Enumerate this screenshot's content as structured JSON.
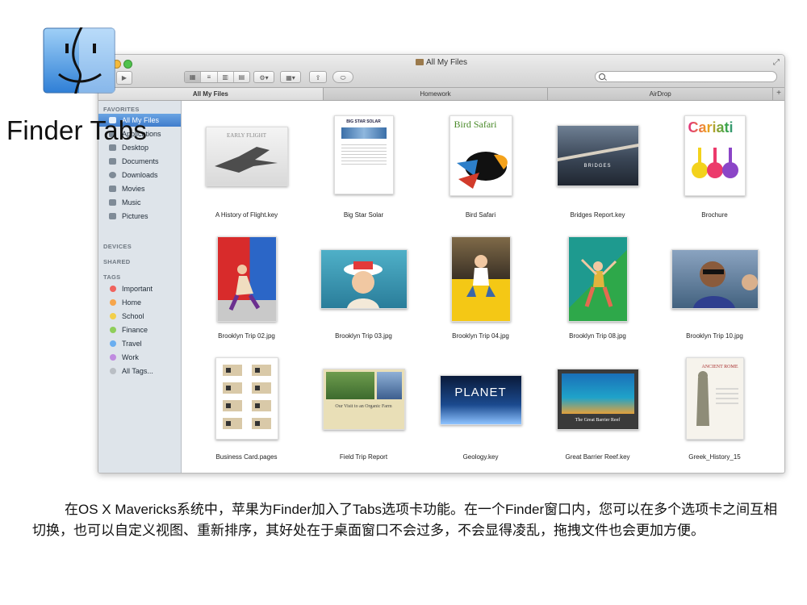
{
  "headline": "Finder Tabs",
  "window": {
    "title": "All My Files",
    "search_placeholder": ""
  },
  "tabs": [
    {
      "label": "All My Files",
      "active": true
    },
    {
      "label": "Homework",
      "active": false
    },
    {
      "label": "AirDrop",
      "active": false
    }
  ],
  "sidebar": {
    "favorites_header": "FAVORITES",
    "favorites": [
      {
        "label": "All My Files",
        "icon": "all-files-icon",
        "selected": true
      },
      {
        "label": "Applications",
        "icon": "applications-icon",
        "selected": false
      },
      {
        "label": "Desktop",
        "icon": "desktop-icon",
        "selected": false
      },
      {
        "label": "Documents",
        "icon": "documents-icon",
        "selected": false
      },
      {
        "label": "Downloads",
        "icon": "downloads-icon",
        "selected": false
      },
      {
        "label": "Movies",
        "icon": "movies-icon",
        "selected": false
      },
      {
        "label": "Music",
        "icon": "music-icon",
        "selected": false
      },
      {
        "label": "Pictures",
        "icon": "pictures-icon",
        "selected": false
      }
    ],
    "devices_header": "DEVICES",
    "shared_header": "SHARED",
    "tags_header": "TAGS",
    "tags": [
      {
        "label": "Important",
        "color": "#f0635e"
      },
      {
        "label": "Home",
        "color": "#f6a54b"
      },
      {
        "label": "School",
        "color": "#f2cf4a"
      },
      {
        "label": "Finance",
        "color": "#8fce5a"
      },
      {
        "label": "Travel",
        "color": "#6aaef0"
      },
      {
        "label": "Work",
        "color": "#c08be0"
      },
      {
        "label": "All Tags...",
        "color": "#b9bec4"
      }
    ]
  },
  "files": [
    {
      "name": "A History of Flight.key",
      "thumb_text": "EARLY FLIGHT"
    },
    {
      "name": "Big Star Solar",
      "thumb_text": "BIG STAR SOLAR"
    },
    {
      "name": "Bird Safari",
      "thumb_text": "Bird Safari"
    },
    {
      "name": "Bridges Report.key",
      "thumb_text": "BRIDGES"
    },
    {
      "name": "Brochure",
      "thumb_text": "Cariati"
    },
    {
      "name": "Brooklyn Trip 02.jpg",
      "thumb_text": ""
    },
    {
      "name": "Brooklyn Trip 03.jpg",
      "thumb_text": ""
    },
    {
      "name": "Brooklyn Trip 04.jpg",
      "thumb_text": ""
    },
    {
      "name": "Brooklyn Trip 08.jpg",
      "thumb_text": ""
    },
    {
      "name": "Brooklyn Trip 10.jpg",
      "thumb_text": ""
    },
    {
      "name": "Business Card.pages",
      "thumb_text": ""
    },
    {
      "name": "Field Trip Report",
      "thumb_text": "Our Visit to an Organic Farm"
    },
    {
      "name": "Geology.key",
      "thumb_text": "PLANET"
    },
    {
      "name": "Great Barrier Reef.key",
      "thumb_text": "The Great Barrier Reef"
    },
    {
      "name": "Greek_History_15",
      "thumb_text": "ANCIENT ROME"
    }
  ],
  "caption": "在OS X Mavericks系统中，苹果为Finder加入了Tabs选项卡功能。在一个Finder窗口内，您可以在多个选项卡之间互相切换，也可以自定义视图、重新排序，其好处在于桌面窗口不会过多，不会显得凌乱，拖拽文件也会更加方便。"
}
